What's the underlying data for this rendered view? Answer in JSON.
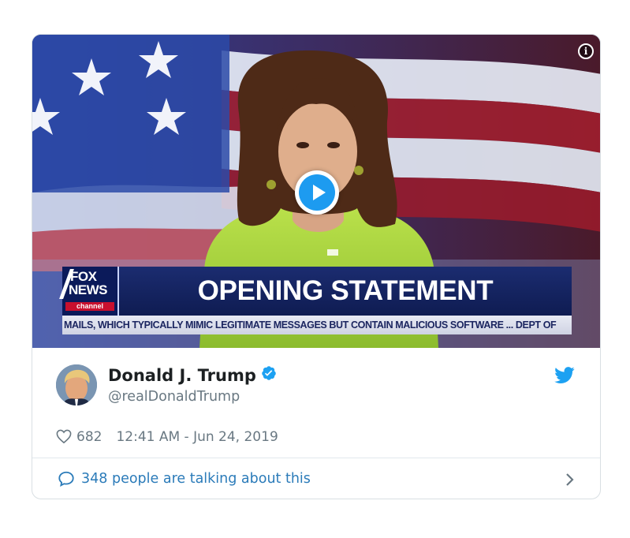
{
  "media": {
    "headline": "OPENING STATEMENT",
    "ticker": "MAILS, WHICH TYPICALLY MIMIC LEGITIMATE MESSAGES BUT CONTAIN MALICIOUS SOFTWARE ...   DEPT OF",
    "logo_fox": "FOX",
    "logo_news": "NEWS",
    "logo_channel": "channel",
    "info_glyph": "i"
  },
  "author": {
    "name": "Donald J. Trump",
    "handle": "@realDonaldTrump"
  },
  "meta": {
    "likes": "682",
    "timestamp": "12:41 AM - Jun 24, 2019"
  },
  "footer": {
    "talking": "348 people are talking about this"
  },
  "colors": {
    "accent": "#1d9bf0",
    "link": "#2b7bb9",
    "muted": "#697882",
    "verified": "#1da1f2"
  },
  "icons": [
    "info-icon",
    "play-icon",
    "verified-badge-icon",
    "twitter-bird-icon",
    "heart-icon",
    "speech-bubble-icon",
    "chevron-right-icon"
  ]
}
